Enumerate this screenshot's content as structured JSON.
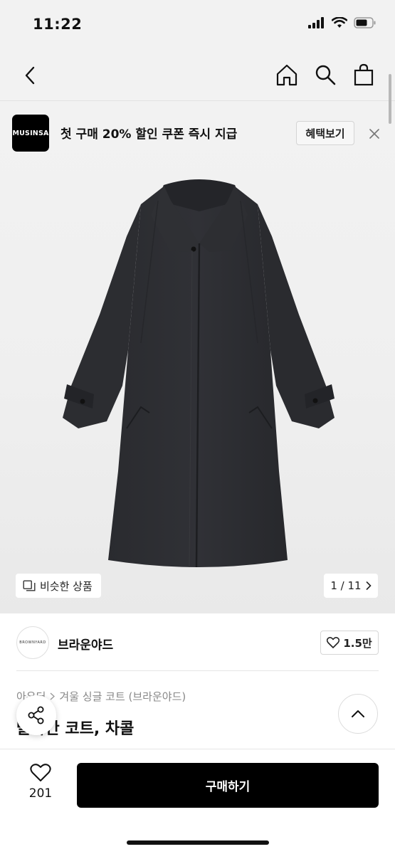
{
  "status_bar": {
    "time": "11:22"
  },
  "promo": {
    "logo_text": "MUSINSA",
    "text": "첫 구매 20% 할인 쿠폰 즉시 지급",
    "button_label": "혜택보기"
  },
  "gallery": {
    "similar_label": "비슷한 상품",
    "page_indicator": "1 / 11"
  },
  "brand": {
    "logo_text": "BROWNYARD",
    "name": "브라운야드",
    "like_count": "1.5만"
  },
  "product": {
    "breadcrumb": [
      "아우터",
      "겨울 싱글 코트 (브라운야드)"
    ],
    "title": "발마칸 코트, 차콜"
  },
  "bottom_bar": {
    "wish_count": "201",
    "buy_label": "구매하기"
  },
  "colors": {
    "buy_button": "#000000",
    "background": "#f2f2f2"
  }
}
